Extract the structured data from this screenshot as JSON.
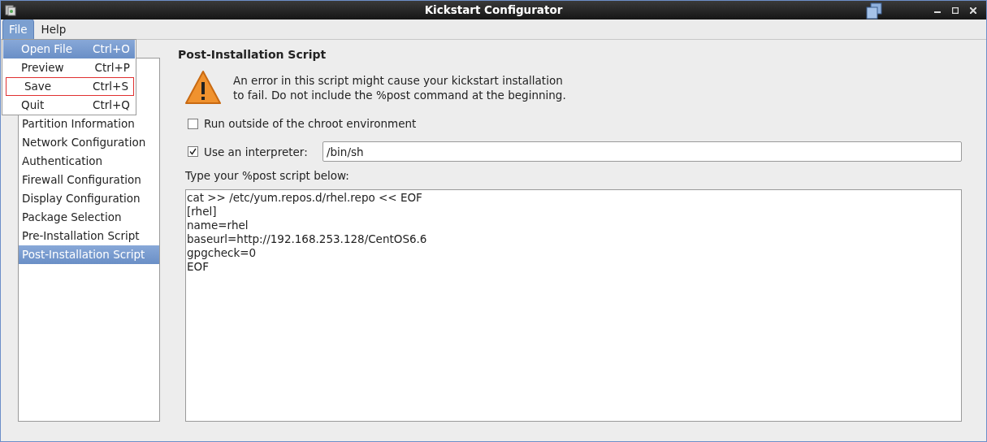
{
  "window": {
    "title": "Kickstart Configurator"
  },
  "menubar": [
    {
      "label": "File",
      "selected": true
    },
    {
      "label": "Help",
      "selected": false
    }
  ],
  "file_menu": [
    {
      "label": "Open File",
      "shortcut": "Ctrl+O",
      "selected": true,
      "outlined": false
    },
    {
      "label": "Preview",
      "shortcut": "Ctrl+P",
      "selected": false,
      "outlined": false
    },
    {
      "label": "Save",
      "shortcut": "Ctrl+S",
      "selected": false,
      "outlined": true
    },
    {
      "label": "Quit",
      "shortcut": "Ctrl+Q",
      "selected": false,
      "outlined": false
    }
  ],
  "sidebar": {
    "items": [
      {
        "label": "Partition Information",
        "selected": false
      },
      {
        "label": "Network Configuration",
        "selected": false
      },
      {
        "label": "Authentication",
        "selected": false
      },
      {
        "label": "Firewall Configuration",
        "selected": false
      },
      {
        "label": "Display Configuration",
        "selected": false
      },
      {
        "label": "Package Selection",
        "selected": false
      },
      {
        "label": "Pre-Installation Script",
        "selected": false
      },
      {
        "label": "Post-Installation Script",
        "selected": true
      }
    ]
  },
  "panel": {
    "title": "Post-Installation Script",
    "warning": "An error in this script might cause your kickstart installation to fail. Do not include the %post command at the beginning.",
    "run_outside": {
      "label": "Run outside of the chroot environment",
      "checked": false
    },
    "interpreter": {
      "label": "Use an interpreter:",
      "checked": true,
      "value": "/bin/sh"
    },
    "script_label": "Type your %post script below:",
    "script_lines": [
      "cat >> /etc/yum.repos.d/rhel.repo << EOF",
      "[rhel]",
      "name=rhel",
      "baseurl=http://192.168.253.128/CentOS6.6",
      "gpgcheck=0",
      "EOF"
    ]
  }
}
